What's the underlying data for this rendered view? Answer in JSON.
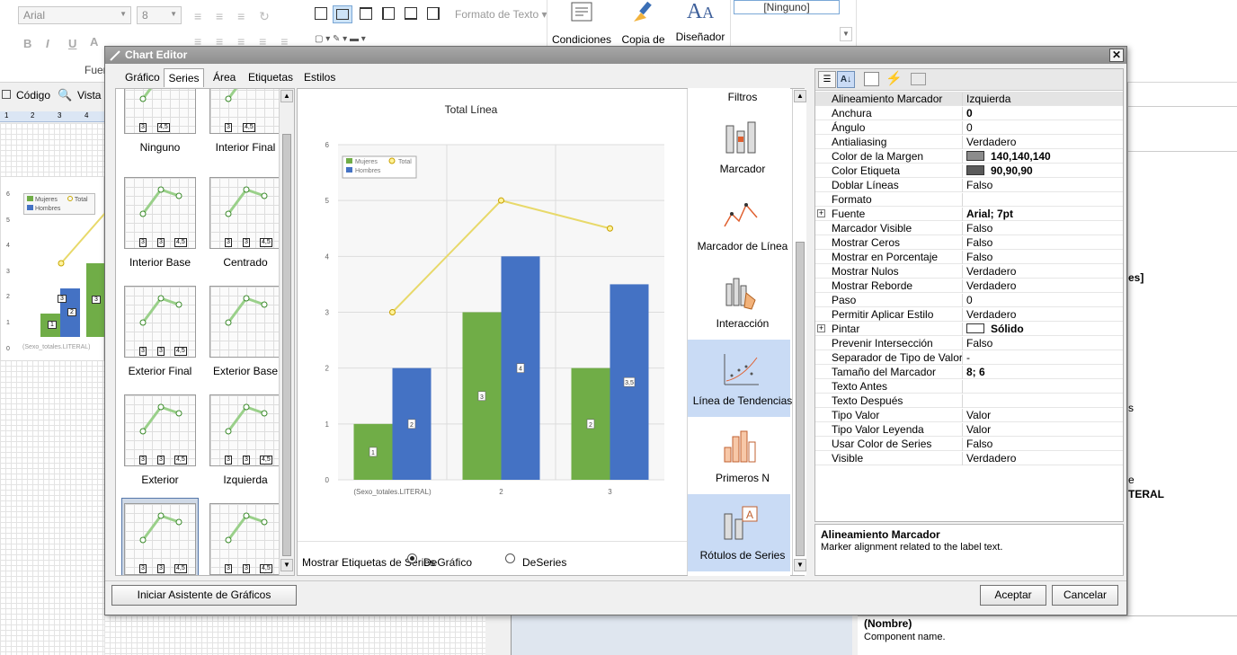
{
  "ribbon": {
    "font_name": "Arial",
    "font_size": "8",
    "bold": "B",
    "italic": "I",
    "underline": "U",
    "font_group": "Fuer",
    "format_text": "Formato de Texto",
    "conditions": "Condiciones",
    "copy_style": "Copia de",
    "designer": "Diseñador",
    "style_box": "[Ninguno]"
  },
  "background": {
    "code_tab": "Código",
    "view_tab": "Vista",
    "ruler": [
      "1",
      "2",
      "3",
      "4"
    ],
    "mini_chart": {
      "legend": [
        "Mujeres",
        "Total",
        "Hombres"
      ],
      "yticks": [
        "6",
        "5",
        "4",
        "3",
        "2",
        "1",
        "0"
      ],
      "labels": [
        "1",
        "2",
        "3",
        "3"
      ],
      "xlabel": "(Sexo_totales.LITERAL)"
    },
    "right_panel": {
      "fragment1": "es]",
      "fragment2": "s",
      "fragment3": "e",
      "fragment4": "TERAL",
      "name_title": "(Nombre)",
      "name_desc": "Component name."
    }
  },
  "dialog": {
    "title": "Chart Editor",
    "close": "✕",
    "tabs": [
      "Gráfico",
      "Series",
      "Área",
      "Etiquetas",
      "Estilos"
    ],
    "active_tab": "Series",
    "label_styles": [
      {
        "label": "Ninguno",
        "boxes": [
          "3",
          "4,5"
        ]
      },
      {
        "label": "Interior Final",
        "boxes": [
          "3",
          "4,5"
        ]
      },
      {
        "label": "Interior Base",
        "boxes": [
          "3",
          "3",
          "4,5"
        ]
      },
      {
        "label": "Centrado",
        "boxes": [
          "3",
          "3",
          "4,5"
        ]
      },
      {
        "label": "Exterior Final",
        "boxes": [
          "3",
          "3",
          "4,5"
        ]
      },
      {
        "label": "Exterior Base",
        "boxes": []
      },
      {
        "label": "Exterior",
        "boxes": [
          "3",
          "3",
          "4,5"
        ]
      },
      {
        "label": "Izquierda",
        "boxes": [
          "3",
          "3",
          "4,5"
        ]
      },
      {
        "label": "",
        "boxes": [
          "3",
          "3",
          "4,5"
        ]
      },
      {
        "label": "",
        "boxes": [
          "3",
          "3",
          "4,5"
        ]
      }
    ],
    "preview": {
      "show_labels_text": "Mostrar Etiquetas de Series",
      "option_chart": "DeGráfico",
      "option_series": "DeSeries"
    },
    "filters_title": "Filtros",
    "filters": [
      {
        "label": "Marcador",
        "icon": "marker-chart-icon",
        "selected": false
      },
      {
        "label": "Marcador de Línea",
        "icon": "line-marker-icon",
        "selected": false
      },
      {
        "label": "Interacción",
        "icon": "interaction-icon",
        "selected": false
      },
      {
        "label": "Línea de Tendencias",
        "icon": "trendline-icon",
        "selected": true
      },
      {
        "label": "Primeros N",
        "icon": "top-n-icon",
        "selected": false
      },
      {
        "label": "Rótulos de Series",
        "icon": "series-labels-icon",
        "selected": true
      }
    ],
    "properties": [
      {
        "name": "Alineamiento Marcador",
        "value": "Izquierda",
        "bold": false,
        "expand": false,
        "swatch": null
      },
      {
        "name": "Anchura",
        "value": "0",
        "bold": true,
        "expand": false,
        "swatch": null
      },
      {
        "name": "Ángulo",
        "value": "0",
        "bold": false,
        "expand": false,
        "swatch": null
      },
      {
        "name": "Antialiasing",
        "value": "Verdadero",
        "bold": false,
        "expand": false,
        "swatch": null
      },
      {
        "name": "Color de la Margen",
        "value": "140,140,140",
        "bold": true,
        "expand": false,
        "swatch": "#8c8c8c"
      },
      {
        "name": "Color Etiqueta",
        "value": "90,90,90",
        "bold": true,
        "expand": false,
        "swatch": "#5a5a5a"
      },
      {
        "name": "Doblar Líneas",
        "value": "Falso",
        "bold": false,
        "expand": false,
        "swatch": null
      },
      {
        "name": "Formato",
        "value": "",
        "bold": false,
        "expand": false,
        "swatch": null
      },
      {
        "name": "Fuente",
        "value": "Arial; 7pt",
        "bold": true,
        "expand": true,
        "swatch": null
      },
      {
        "name": "Marcador Visible",
        "value": "Falso",
        "bold": false,
        "expand": false,
        "swatch": null
      },
      {
        "name": "Mostrar Ceros",
        "value": "Falso",
        "bold": false,
        "expand": false,
        "swatch": null
      },
      {
        "name": "Mostrar en Porcentaje",
        "value": "Falso",
        "bold": false,
        "expand": false,
        "swatch": null
      },
      {
        "name": "Mostrar Nulos",
        "value": "Verdadero",
        "bold": false,
        "expand": false,
        "swatch": null
      },
      {
        "name": "Mostrar Reborde",
        "value": "Verdadero",
        "bold": false,
        "expand": false,
        "swatch": null
      },
      {
        "name": "Paso",
        "value": "0",
        "bold": false,
        "expand": false,
        "swatch": null
      },
      {
        "name": "Permitir Aplicar Estilo",
        "value": "Verdadero",
        "bold": false,
        "expand": false,
        "swatch": null
      },
      {
        "name": "Pintar",
        "value": "Sólido",
        "bold": true,
        "expand": true,
        "swatch": "#ffffff"
      },
      {
        "name": "Prevenir Intersección",
        "value": "Falso",
        "bold": false,
        "expand": false,
        "swatch": null
      },
      {
        "name": "Separador de Tipo de Valor",
        "value": "-",
        "bold": false,
        "expand": false,
        "swatch": null
      },
      {
        "name": "Tamaño del Marcador",
        "value": "8; 6",
        "bold": true,
        "expand": false,
        "swatch": null
      },
      {
        "name": "Texto Antes",
        "value": "",
        "bold": false,
        "expand": false,
        "swatch": null
      },
      {
        "name": "Texto Después",
        "value": "",
        "bold": false,
        "expand": false,
        "swatch": null
      },
      {
        "name": "Tipo Valor",
        "value": "Valor",
        "bold": false,
        "expand": false,
        "swatch": null
      },
      {
        "name": "Tipo Valor Leyenda",
        "value": "Valor",
        "bold": false,
        "expand": false,
        "swatch": null
      },
      {
        "name": "Usar Color de Series",
        "value": "Falso",
        "bold": false,
        "expand": false,
        "swatch": null
      },
      {
        "name": "Visible",
        "value": "Verdadero",
        "bold": false,
        "expand": false,
        "swatch": null
      }
    ],
    "description": {
      "title": "Alineamiento Marcador",
      "text": "Marker alignment related to the label text."
    },
    "buttons": {
      "wizard": "Iniciar Asistente de Gráficos",
      "ok": "Aceptar",
      "cancel": "Cancelar"
    }
  },
  "chart_data": {
    "type": "bar",
    "title": "Total Línea",
    "categories": [
      "(Sexo_totales.LITERAL)",
      "2",
      "3"
    ],
    "series": [
      {
        "name": "Mujeres",
        "type": "bar",
        "color": "#70ad47",
        "values": [
          1,
          3,
          2
        ],
        "labels": [
          "1",
          "3",
          "2"
        ]
      },
      {
        "name": "Hombres",
        "type": "bar",
        "color": "#4472c4",
        "values": [
          2,
          4,
          3.5
        ],
        "labels": [
          "2",
          "4",
          "3,5"
        ]
      },
      {
        "name": "Total",
        "type": "line",
        "color": "#e8d96a",
        "values": [
          3,
          5,
          4.5
        ],
        "labels": [
          "3",
          "5",
          "4,5"
        ]
      }
    ],
    "ylim": [
      0,
      6
    ],
    "yticks": [
      "0",
      "1",
      "2",
      "3",
      "4",
      "5",
      "6"
    ],
    "legend": [
      "Mujeres",
      "Total",
      "Hombres"
    ],
    "legend_position": "top-left",
    "grid": true
  }
}
